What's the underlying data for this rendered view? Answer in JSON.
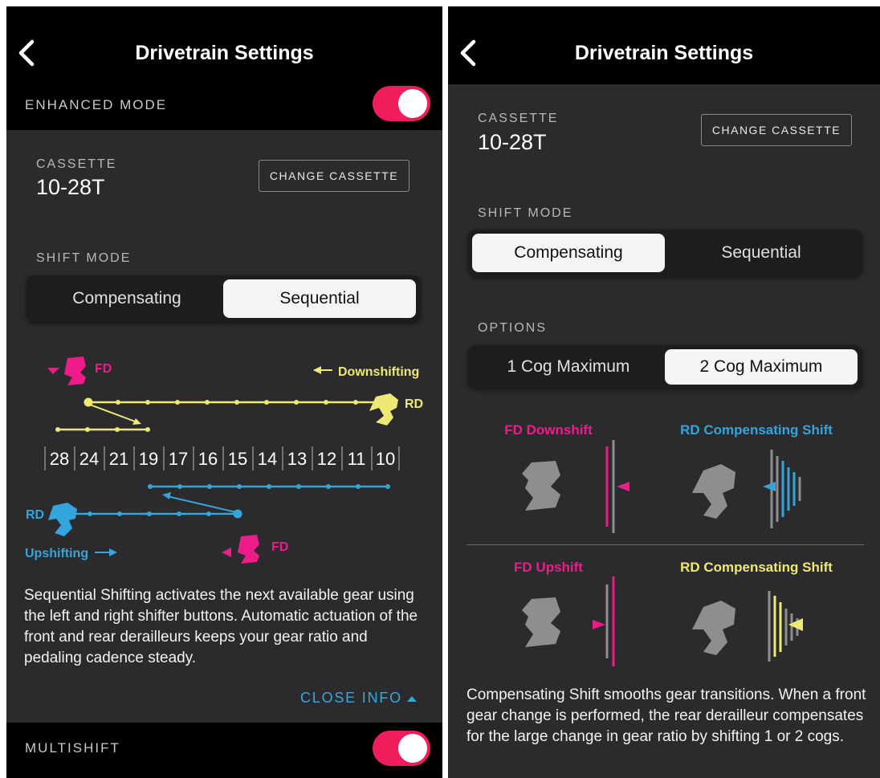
{
  "header": {
    "title": "Drivetrain Settings"
  },
  "enhanced_mode": {
    "label": "ENHANCED MODE"
  },
  "multishift": {
    "label": "MULTISHIFT"
  },
  "cassette": {
    "label": "CASSETTE",
    "value": "10-28T",
    "change_label": "CHANGE CASSETTE"
  },
  "shift_mode": {
    "label": "SHIFT MODE",
    "options": [
      "Compensating",
      "Sequential"
    ]
  },
  "options": {
    "label": "OPTIONS",
    "items": [
      "1 Cog Maximum",
      "2 Cog Maximum"
    ]
  },
  "diagram": {
    "fd_label": "FD",
    "rd_label": "RD",
    "downshifting": "Downshifting",
    "upshifting": "Upshifting",
    "cogs": [
      "28",
      "24",
      "21",
      "19",
      "17",
      "16",
      "15",
      "14",
      "13",
      "12",
      "11",
      "10"
    ]
  },
  "left_info": {
    "text": "Sequential Shifting activates the next available gear using the left and right shifter buttons. Automatic actuation of the front and rear derailleurs keeps your gear ratio and pedaling cadence steady.",
    "close_label": "CLOSE INFO"
  },
  "comp_diagram": {
    "fd_downshift": "FD Downshift",
    "rd_comp_1": "RD Compensating Shift",
    "fd_upshift": "FD Upshift",
    "rd_comp_2": "RD Compensating Shift"
  },
  "right_info": {
    "text": "Compensating Shift smooths gear transitions. When a front gear change is performed, the rear derailleur compensates for the large change in gear ratio by shifting 1 or 2 cogs."
  },
  "colors": {
    "toggle_on": "#ef1d5b",
    "magenta": "#ee1c8b",
    "yellow": "#efe873",
    "blue": "#33a4dc",
    "link": "#3aa6e0"
  },
  "state": {
    "enhanced_mode_on": true,
    "multishift_on": true,
    "left_shift_mode": "Sequential",
    "right_shift_mode": "Compensating",
    "right_option": "2 Cog Maximum"
  }
}
